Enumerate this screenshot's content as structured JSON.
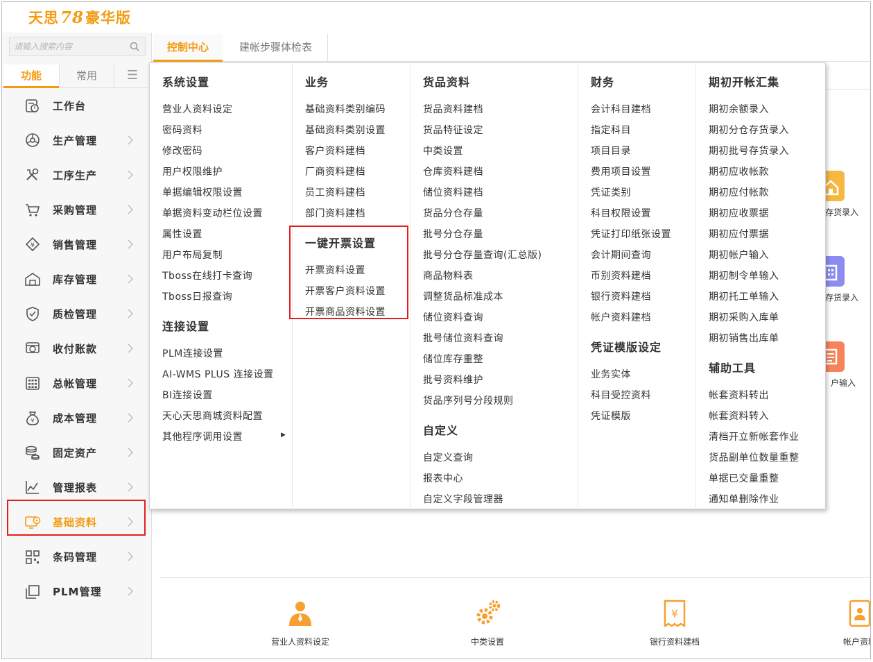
{
  "app": {
    "logo_part1": "天思",
    "logo_78": "78",
    "logo_part2": "豪华版"
  },
  "search": {
    "placeholder": "请输入搜索内容"
  },
  "sidebar_tabs": {
    "functions": "功能",
    "common": "常用"
  },
  "nav": [
    {
      "label": "工作台",
      "icon": "workbench-icon",
      "arrow": false
    },
    {
      "label": "生产管理",
      "icon": "production-icon",
      "arrow": true
    },
    {
      "label": "工序生产",
      "icon": "tools-icon",
      "arrow": true
    },
    {
      "label": "采购管理",
      "icon": "cart-icon",
      "arrow": true
    },
    {
      "label": "销售管理",
      "icon": "sales-icon",
      "arrow": true
    },
    {
      "label": "库存管理",
      "icon": "warehouse-icon",
      "arrow": true
    },
    {
      "label": "质检管理",
      "icon": "shield-icon",
      "arrow": true
    },
    {
      "label": "收付账款",
      "icon": "payment-icon",
      "arrow": true
    },
    {
      "label": "总帐管理",
      "icon": "calculator-icon",
      "arrow": true
    },
    {
      "label": "成本管理",
      "icon": "money-bag-icon",
      "arrow": true
    },
    {
      "label": "固定资产",
      "icon": "coins-icon",
      "arrow": true
    },
    {
      "label": "管理报表",
      "icon": "chart-icon",
      "arrow": true
    },
    {
      "label": "基础资料",
      "icon": "settings-monitor-icon",
      "arrow": true
    },
    {
      "label": "条码管理",
      "icon": "barcode-icon",
      "arrow": true
    },
    {
      "label": "PLM管理",
      "icon": "copy-icon",
      "arrow": true
    }
  ],
  "tabs": [
    {
      "label": "控制中心"
    },
    {
      "label": "建帐步骤体检表"
    }
  ],
  "menu": {
    "col1": {
      "groups": [
        {
          "title": "系统设置",
          "items": [
            "营业人资料设定",
            "密码资料",
            "修改密码",
            "用户权限维护",
            "单据编辑权限设置",
            "单据资料变动栏位设置",
            "属性设置",
            "用户布局复制",
            "Tboss在线打卡查询",
            "Tboss日报查询"
          ]
        },
        {
          "title": "连接设置",
          "items": [
            "PLM连接设置",
            "AI-WMS PLUS 连接设置",
            "BI连接设置",
            "天心天思商城资料配置",
            "其他程序调用设置"
          ]
        }
      ]
    },
    "col2": {
      "groups": [
        {
          "title": "业务",
          "items": [
            "基础资料类别编码",
            "基础资料类别设置",
            "客户资料建档",
            "厂商资料建档",
            "员工资料建档",
            "部门资料建档"
          ]
        },
        {
          "title": "一键开票设置",
          "items": [
            "开票资料设置",
            "开票客户资料设置",
            "开票商品资料设置"
          ]
        }
      ]
    },
    "col3": {
      "groups": [
        {
          "title": "货品资料",
          "items": [
            "货品资料建档",
            "货品特征设定",
            "中类设置",
            "仓库资料建档",
            "储位资料建档",
            "货品分仓存量",
            "批号分仓存量",
            "批号分仓存量查询(汇总版)",
            "商品物料表",
            "调整货品标准成本",
            "储位资料查询",
            "批号储位资料查询",
            "储位库存重整",
            "批号资料维护",
            "货品序列号分段规则"
          ]
        },
        {
          "title": "自定义",
          "items": [
            "自定义查询",
            "报表中心",
            "自定义字段管理器"
          ]
        }
      ]
    },
    "col4": {
      "groups": [
        {
          "title": "财务",
          "items": [
            "会计科目建档",
            "指定科目",
            "项目目录",
            "费用项目设置",
            "凭证类别",
            "科目权限设置",
            "凭证打印纸张设置",
            "会计期间查询",
            "币别资料建档",
            "银行资料建档",
            "帐户资料建档"
          ]
        },
        {
          "title": "凭证模版设定",
          "items": [
            "业务实体",
            "科目受控资料",
            "凭证模版"
          ]
        }
      ]
    },
    "col5": {
      "groups": [
        {
          "title": "期初开帐汇集",
          "items": [
            "期初余额录入",
            "期初分仓存货录入",
            "期初批号存货录入",
            "期初应收帐款",
            "期初应付帐款",
            "期初应收票据",
            "期初应付票据",
            "期初帐户输入",
            "期初制令单输入",
            "期初托工单输入",
            "期初采购入库单",
            "期初销售出库单"
          ]
        },
        {
          "title": "辅助工具",
          "items": [
            "帐套资料转出",
            "帐套资料转入",
            "清档开立新帐套作业",
            "货品副单位数量重整",
            "单据已交量重整",
            "通知单删除作业"
          ]
        }
      ]
    }
  },
  "background_right_labels": [
    "存货录入",
    "存货录入",
    "户输入"
  ],
  "bottom_shortcuts": [
    {
      "label": "营业人资料设定",
      "icon": "person-icon"
    },
    {
      "label": "中类设置",
      "icon": "gears-icon"
    },
    {
      "label": "银行资料建档",
      "icon": "bank-receipt-icon"
    },
    {
      "label": "帐户资料",
      "icon": "account-icon"
    }
  ],
  "colors": {
    "accent": "#f39c12",
    "highlight_box": "#e02020"
  }
}
